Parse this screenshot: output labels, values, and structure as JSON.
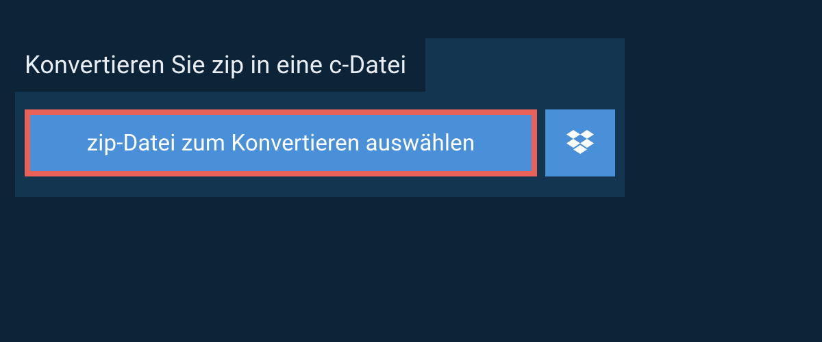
{
  "heading": {
    "title": "Konvertieren Sie zip in eine c-Datei"
  },
  "upload": {
    "select_file_label": "zip-Datei zum Konvertieren auswählen",
    "dropbox_icon_name": "dropbox-icon"
  },
  "colors": {
    "page_bg": "#0d2438",
    "panel_bg": "#14354f",
    "button_bg": "#4a90d9",
    "button_border": "#e86259",
    "text_light": "#e8eef3",
    "text_white": "#ffffff"
  }
}
